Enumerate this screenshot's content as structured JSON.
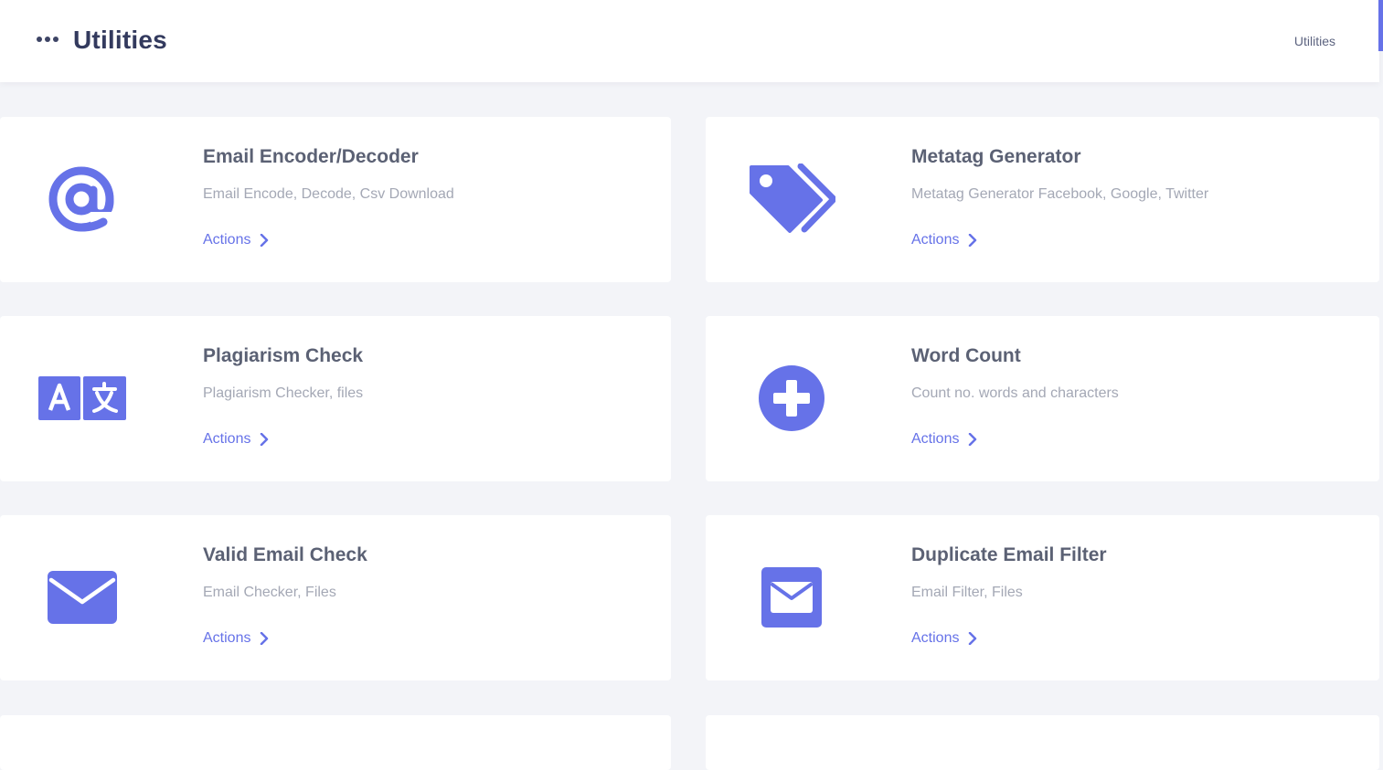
{
  "header": {
    "title": "Utilities",
    "breadcrumb": "Utilities",
    "menu_icon": "more-horizontal-icon"
  },
  "colors": {
    "accent": "#6672e8",
    "title_text": "#333a5e",
    "card_title": "#5b6174",
    "card_subtitle": "#a4a8b5",
    "background": "#f3f4f8"
  },
  "cards": [
    {
      "title": "Email Encoder/Decoder",
      "subtitle": "Email Encode, Decode, Csv Download",
      "action": "Actions",
      "icon": "at-sign-icon"
    },
    {
      "title": "Metatag Generator",
      "subtitle": "Metatag Generator Facebook, Google, Twitter",
      "action": "Actions",
      "icon": "tags-icon"
    },
    {
      "title": "Plagiarism Check",
      "subtitle": "Plagiarism Checker, files",
      "action": "Actions",
      "icon": "language-icon"
    },
    {
      "title": "Word Count",
      "subtitle": "Count no. words and characters",
      "action": "Actions",
      "icon": "plus-circle-icon"
    },
    {
      "title": "Valid Email Check",
      "subtitle": "Email Checker, Files",
      "action": "Actions",
      "icon": "envelope-icon"
    },
    {
      "title": "Duplicate Email Filter",
      "subtitle": "Email Filter, Files",
      "action": "Actions",
      "icon": "envelope-square-icon"
    }
  ]
}
